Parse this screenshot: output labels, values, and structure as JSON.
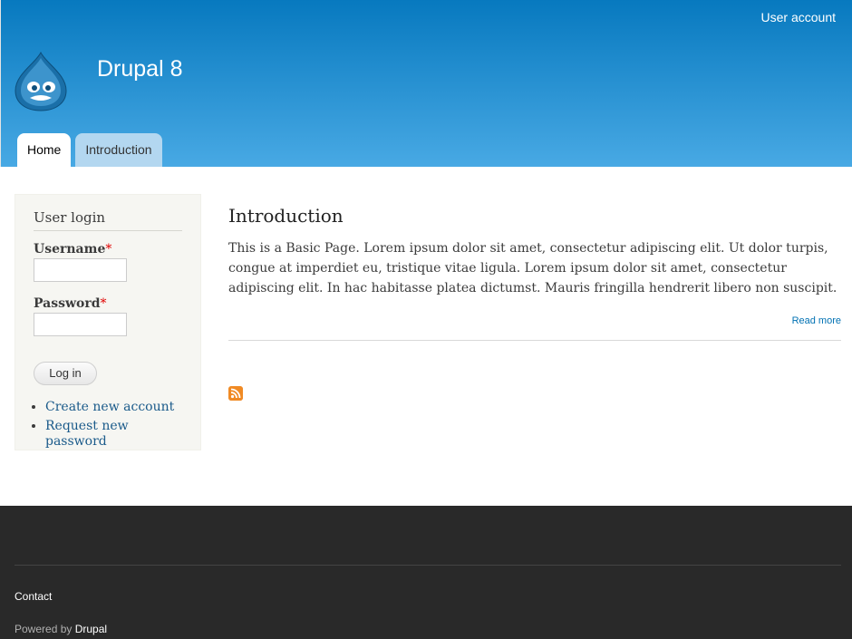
{
  "header": {
    "user_account": "User account",
    "site_name": "Drupal 8"
  },
  "tabs": [
    {
      "label": "Home",
      "active": true
    },
    {
      "label": "Introduction",
      "active": false
    }
  ],
  "login_block": {
    "title": "User login",
    "username_label": "Username",
    "password_label": "Password",
    "required_marker": "*",
    "submit_label": "Log in",
    "links": [
      "Create new account",
      "Request new password"
    ]
  },
  "node": {
    "title": "Introduction",
    "body": "This is a Basic Page. Lorem ipsum dolor sit amet, consectetur adipiscing elit. Ut dolor turpis, congue at imperdiet eu, tristique vitae ligula. Lorem ipsum dolor sit amet, consectetur adipiscing elit. In hac habitasse platea dictumst. Mauris fringilla hendrerit libero non suscipit.",
    "read_more": "Read more"
  },
  "footer": {
    "contact": "Contact",
    "powered_prefix": "Powered by ",
    "powered_link": "Drupal"
  },
  "colors": {
    "header_top": "#0779bf",
    "header_bottom": "#48a9e4",
    "footer_bg": "#292929",
    "link": "#0071b3"
  },
  "icons": {
    "logo": "drupal-drop-logo",
    "feed": "rss-feed-icon"
  }
}
